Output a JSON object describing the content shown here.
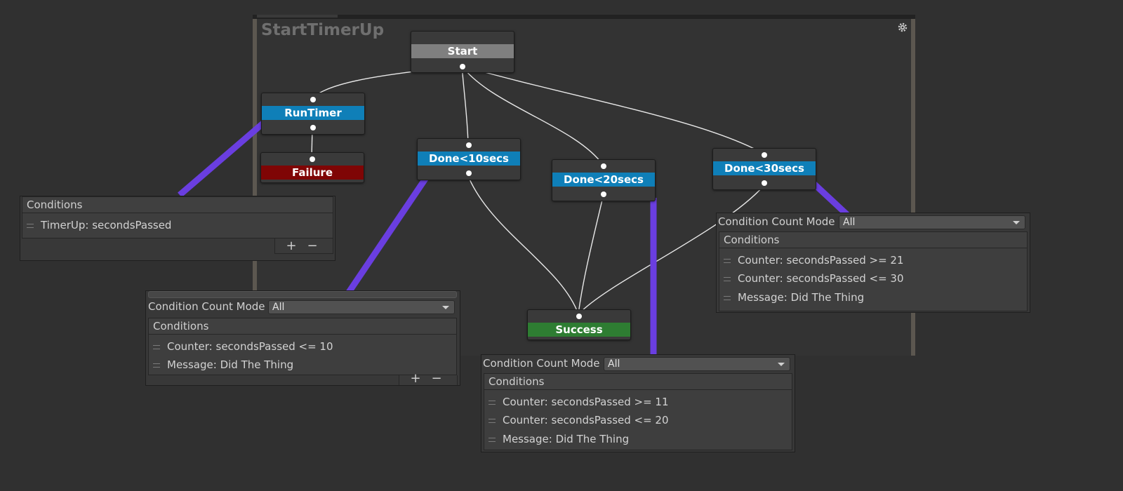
{
  "graph": {
    "title": "StartTimerUp",
    "nodes": {
      "start": "Start",
      "run_timer": "RunTimer",
      "failure": "Failure",
      "done10": "Done<10secs",
      "done20": "Done<20secs",
      "done30": "Done<30secs",
      "success": "Success"
    },
    "colors": {
      "start_bar": "#7f7f7f",
      "task_bar": "#0f7fb8",
      "failure_bar": "#7f0505",
      "success_bar": "#2e7d32",
      "callout": "#6a3ee0"
    }
  },
  "inspectors": {
    "timer": {
      "conditions_header": "Conditions",
      "items": [
        "TimerUp: secondsPassed"
      ],
      "add_label": "+",
      "remove_label": "−"
    },
    "done10": {
      "mode_label": "Condition Count Mode",
      "mode_value": "All",
      "conditions_header": "Conditions",
      "items": [
        "Counter: secondsPassed <= 10",
        "Message: Did The Thing"
      ],
      "add_label": "+",
      "remove_label": "−"
    },
    "done20": {
      "mode_label": "Condition Count Mode",
      "mode_value": "All",
      "conditions_header": "Conditions",
      "items": [
        "Counter: secondsPassed >= 11",
        "Counter: secondsPassed <= 20",
        "Message: Did The Thing"
      ]
    },
    "done30": {
      "mode_label": "Condition Count Mode",
      "mode_value": "All",
      "conditions_header": "Conditions",
      "items": [
        "Counter: secondsPassed >= 21",
        "Counter: secondsPassed <= 30",
        "Message: Did The Thing"
      ]
    }
  }
}
